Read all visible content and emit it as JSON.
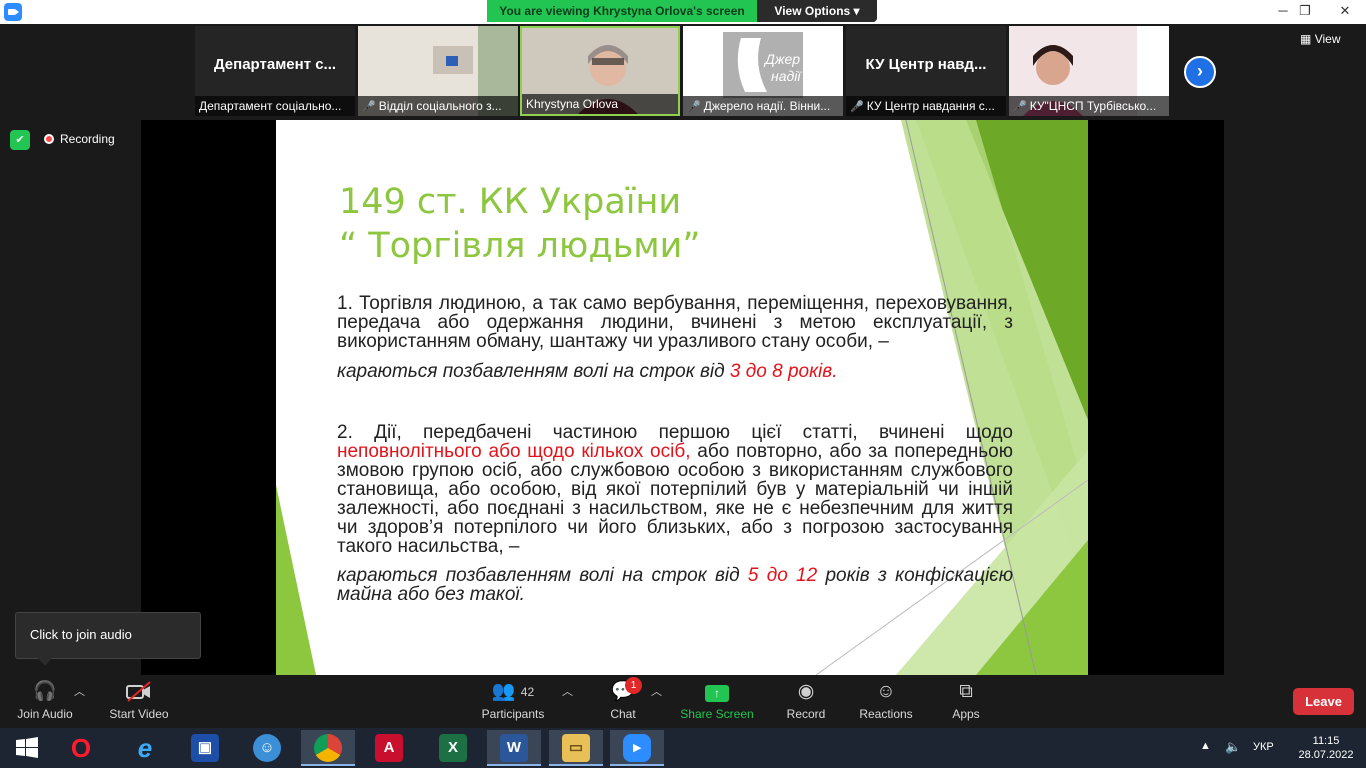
{
  "titlebar": {
    "banner": "You are viewing Khrystyna Orlova's screen",
    "view_options": "View Options",
    "minimize": "─",
    "maximize": "❐",
    "close": "✕"
  },
  "strip": {
    "view_label": "View",
    "tiles": [
      {
        "big": "Департамент с...",
        "caption": "Департамент соціально..."
      },
      {
        "big": "",
        "caption": "Відділ соціального з..."
      },
      {
        "big": "",
        "caption": "Khrystyna Orlova"
      },
      {
        "big": "",
        "caption": "Джерело надії. Вінни..."
      },
      {
        "big": "КУ Центр навд...",
        "caption": "КУ Центр навдання с..."
      },
      {
        "big": "",
        "caption": "КУ\"ЦНСП Турбівсько..."
      }
    ],
    "logo_text_1": "Джер",
    "logo_text_2": "надії"
  },
  "stage": {
    "recording": "Recording",
    "tooltip": "Click to join audio"
  },
  "slide": {
    "title_line1": "149 ст. КК України",
    "title_line2": "“ Торгівля людьми”",
    "p1": "1. Торгівля людиною, а так само вербування, переміщення, переховування, передача або одержання людини, вчинені з метою експлуатації, з використанням обману, шантажу чи уразливого стану особи, –",
    "p1_penalty_a": "караються позбавленням волі на строк від ",
    "p1_penalty_red": "3 до 8 років.",
    "p2_a": "2. Дії, передбачені частиною першою цієї статті, вчинені щодо ",
    "p2_red": "неповнолітнього або щодо кількох осіб,",
    "p2_b": " або повторно, або за попередньою змовою групою осіб, або службовою особою з використанням службового становища, або особою, від якої потерпілий був у матеріальній чи іншій залежності, або поєднані з насильством, яке не є небезпечним для життя чи здоров’я потерпілого чи його близьких, або з погрозою застосування такого насильства, –",
    "p2_penalty_a": "караються позбавленням волі на строк від ",
    "p2_penalty_red": "5 до 12",
    "p2_penalty_b": " років з конфіскацією майна або без такої."
  },
  "toolbar": {
    "join_audio": "Join Audio",
    "start_video": "Start Video",
    "participants_count": "42",
    "participants": "Participants",
    "chat": "Chat",
    "chat_badge": "1",
    "share_screen": "Share Screen",
    "record": "Record",
    "reactions": "Reactions",
    "apps": "Apps",
    "leave": "Leave"
  },
  "taskbar": {
    "language": "УКР",
    "time": "11:15",
    "date": "28.07.2022"
  },
  "colors": {
    "slide_green": "#8dc63f",
    "penalty_red": "#e2131a",
    "banner_green": "#23c552",
    "leave_red": "#d7313a"
  }
}
